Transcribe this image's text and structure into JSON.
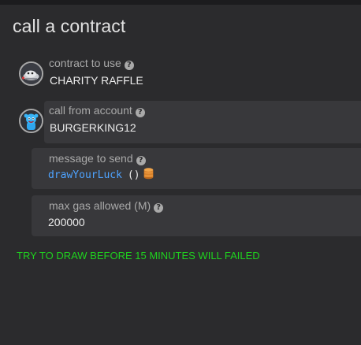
{
  "page": {
    "title": "call a contract"
  },
  "contract": {
    "label": "contract to use",
    "value": "CHARITY RAFFLE",
    "avatar_icon": "raffle-contract-avatar-icon",
    "help_icon": "question-circle-icon"
  },
  "account": {
    "label": "call from account",
    "value": "BURGERKING12",
    "avatar_icon": "blue-character-avatar-icon",
    "help_icon": "question-circle-icon"
  },
  "message": {
    "label": "message to send",
    "method": "drawYourLuck",
    "params": "()",
    "payable_icon": "coins-icon",
    "help_icon": "question-circle-icon"
  },
  "gas": {
    "label": "max gas allowed (M)",
    "value": "200000",
    "help_icon": "question-circle-icon"
  },
  "warning": {
    "text": "TRY TO DRAW BEFORE 15 MINUTES WILL FAILED",
    "color": "#1fd21f"
  },
  "colors": {
    "background": "#2b2b2d",
    "panel": "#38383b",
    "label": "#a9a9a9",
    "method": "#4ea3ff",
    "coins": "#d9822b"
  }
}
